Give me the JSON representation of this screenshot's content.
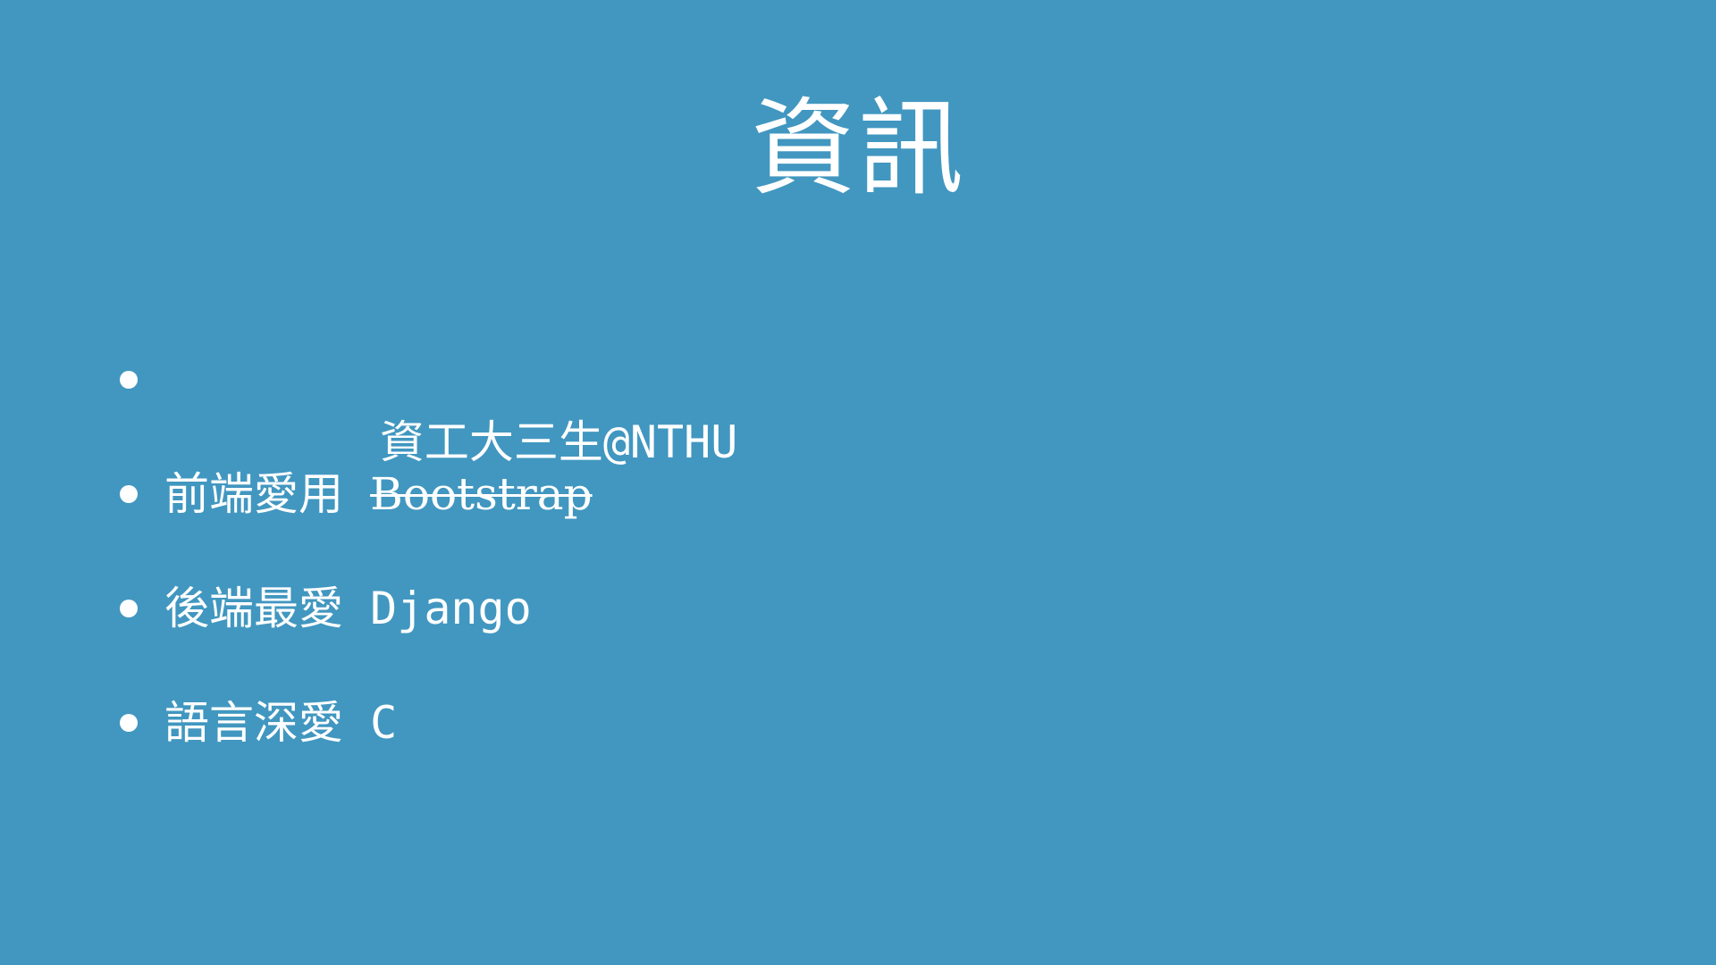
{
  "slide": {
    "title": "資訊",
    "bullets": [
      {
        "prefix": "資工大三生@NTHU",
        "suffix": ""
      },
      {
        "prefix": "前端愛用 ",
        "suffix": "Bootstrap"
      },
      {
        "prefix": "後端最愛 ",
        "suffix": "Django"
      },
      {
        "prefix": "語言深愛 ",
        "suffix": "C"
      }
    ]
  },
  "colors": {
    "background": "#4197C0",
    "text": "#FFFFFF"
  }
}
